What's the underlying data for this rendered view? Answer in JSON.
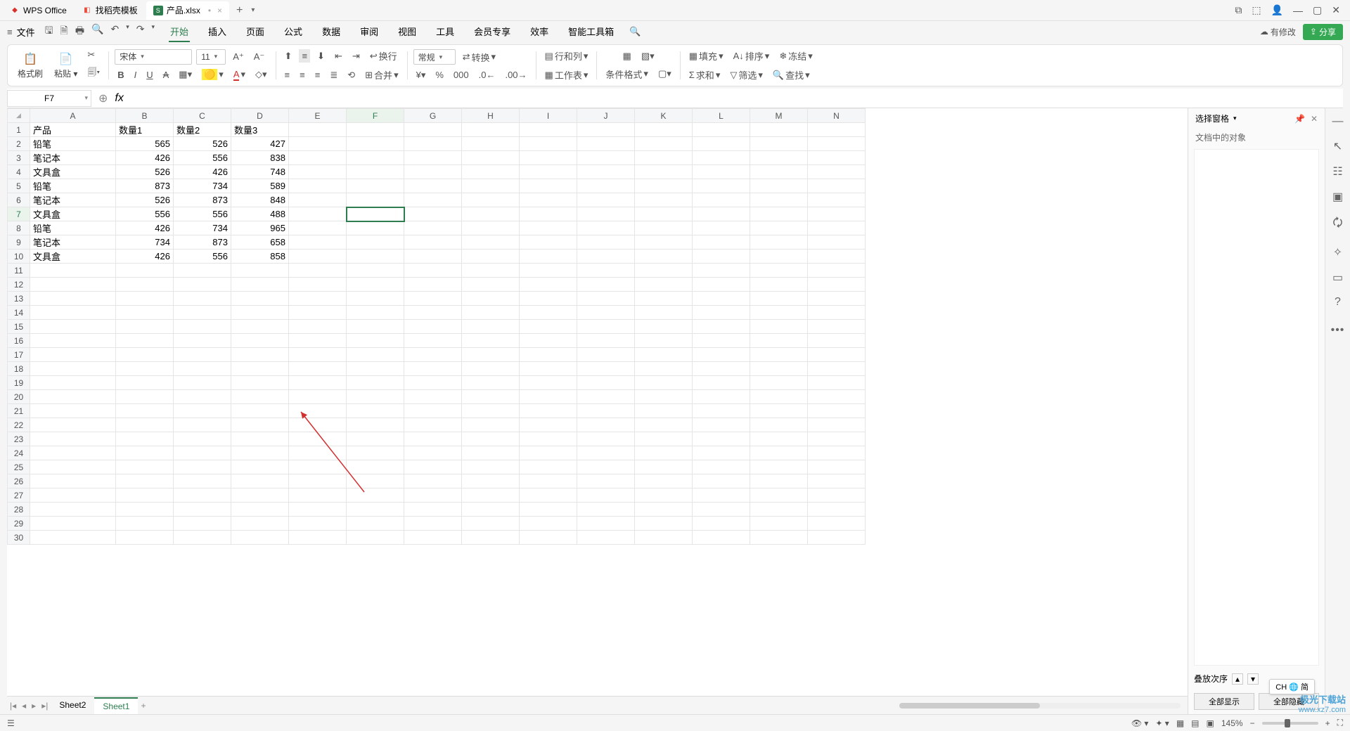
{
  "titlebar": {
    "app_tab": "WPS Office",
    "template_tab": "找稻壳模板",
    "file_tab": "产品.xlsx"
  },
  "menubar": {
    "file": "文件",
    "items": [
      "开始",
      "插入",
      "页面",
      "公式",
      "数据",
      "审阅",
      "视图",
      "工具",
      "会员专享",
      "效率",
      "智能工具箱"
    ],
    "active_index": 0,
    "modify_status": "有修改",
    "share": "分享"
  },
  "ribbon": {
    "format_brush": "格式刷",
    "paste": "粘贴",
    "font_name": "宋体",
    "font_size": "11",
    "wrap": "换行",
    "merge": "合并",
    "number_format": "常规",
    "convert": "转换",
    "rowcol": "行和列",
    "worksheet": "工作表",
    "cond_format": "条件格式",
    "fill": "填充",
    "sort": "排序",
    "freeze": "冻结",
    "sum": "求和",
    "filter": "筛选",
    "find": "查找"
  },
  "formula": {
    "cell_ref": "F7",
    "fx": ""
  },
  "columns": [
    "A",
    "B",
    "C",
    "D",
    "E",
    "F",
    "G",
    "H",
    "I",
    "J",
    "K",
    "L",
    "M",
    "N"
  ],
  "row_count": 30,
  "selected": {
    "col": "F",
    "row": 7
  },
  "table": {
    "headers": [
      "产品",
      "数量1",
      "数量2",
      "数量3"
    ],
    "rows": [
      [
        "铅笔",
        565,
        526,
        427
      ],
      [
        "笔记本",
        426,
        556,
        838
      ],
      [
        "文具盒",
        526,
        426,
        748
      ],
      [
        "铅笔",
        873,
        734,
        589
      ],
      [
        "笔记本",
        526,
        873,
        848
      ],
      [
        "文具盒",
        556,
        556,
        488
      ],
      [
        "铅笔",
        426,
        734,
        965
      ],
      [
        "笔记本",
        734,
        873,
        658
      ],
      [
        "文具盒",
        426,
        556,
        858
      ]
    ]
  },
  "side_panel": {
    "title": "选择窗格",
    "subtitle": "文档中的对象",
    "stack_order": "叠放次序",
    "show_all": "全部显示",
    "hide_all": "全部隐藏"
  },
  "sheets": {
    "tabs": [
      "Sheet2",
      "Sheet1"
    ],
    "active_index": 1
  },
  "statusbar": {
    "zoom": "145%",
    "ime": "CH 🌐 简"
  },
  "watermark": {
    "name": "极光下载站",
    "url": "www.xz7.com"
  }
}
